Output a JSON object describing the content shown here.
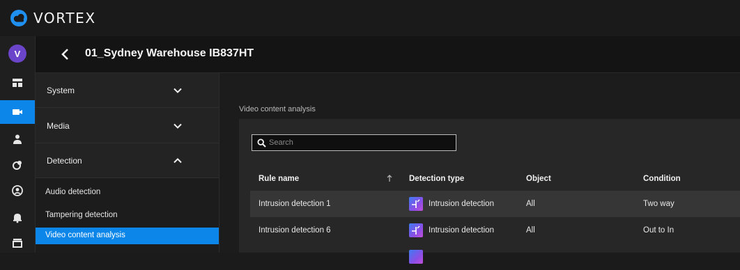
{
  "app": {
    "brand": "VORTEX",
    "logo_icon": "vortex-cloud-logo",
    "accent_color": "#0d86ea"
  },
  "rail": {
    "avatar_initial": "V",
    "avatar_color": "#6b45c9",
    "icons": [
      "dashboard-icon",
      "camera-icon",
      "person-icon",
      "access-icon",
      "profile-icon",
      "bell-icon",
      "more-icon"
    ],
    "active_icon": "camera-icon"
  },
  "header": {
    "back_icon": "chevron-left-icon",
    "device_title": "01_Sydney Warehouse IB837HT"
  },
  "menu": {
    "sections": [
      {
        "label": "System",
        "state": "collapsed",
        "icon": "chevron-down-icon"
      },
      {
        "label": "Media",
        "state": "collapsed",
        "icon": "chevron-down-icon"
      },
      {
        "label": "Detection",
        "state": "expanded",
        "icon": "chevron-up-icon"
      }
    ],
    "sub_items": [
      {
        "label": "Audio detection",
        "active": false
      },
      {
        "label": "Tampering detection",
        "active": false
      },
      {
        "label": "Video content analysis",
        "active": true
      }
    ]
  },
  "content": {
    "breadcrumb": "Video content analysis",
    "search": {
      "placeholder": "Search",
      "value": "",
      "icon": "search-icon"
    },
    "table": {
      "columns": [
        "Rule name",
        "Detection type",
        "Object",
        "Condition"
      ],
      "sort_icon": "sort-arrow-up-icon",
      "rows": [
        {
          "rule_name": "Intrusion detection 1",
          "detection_type": "Intrusion detection",
          "type_icon": "intrusion-detection-icon",
          "object": "All",
          "condition": "Two way",
          "selected": true
        },
        {
          "rule_name": "Intrusion detection 6",
          "detection_type": "Intrusion detection",
          "type_icon": "intrusion-detection-icon",
          "object": "All",
          "condition": "Out to In",
          "selected": false
        }
      ]
    }
  }
}
